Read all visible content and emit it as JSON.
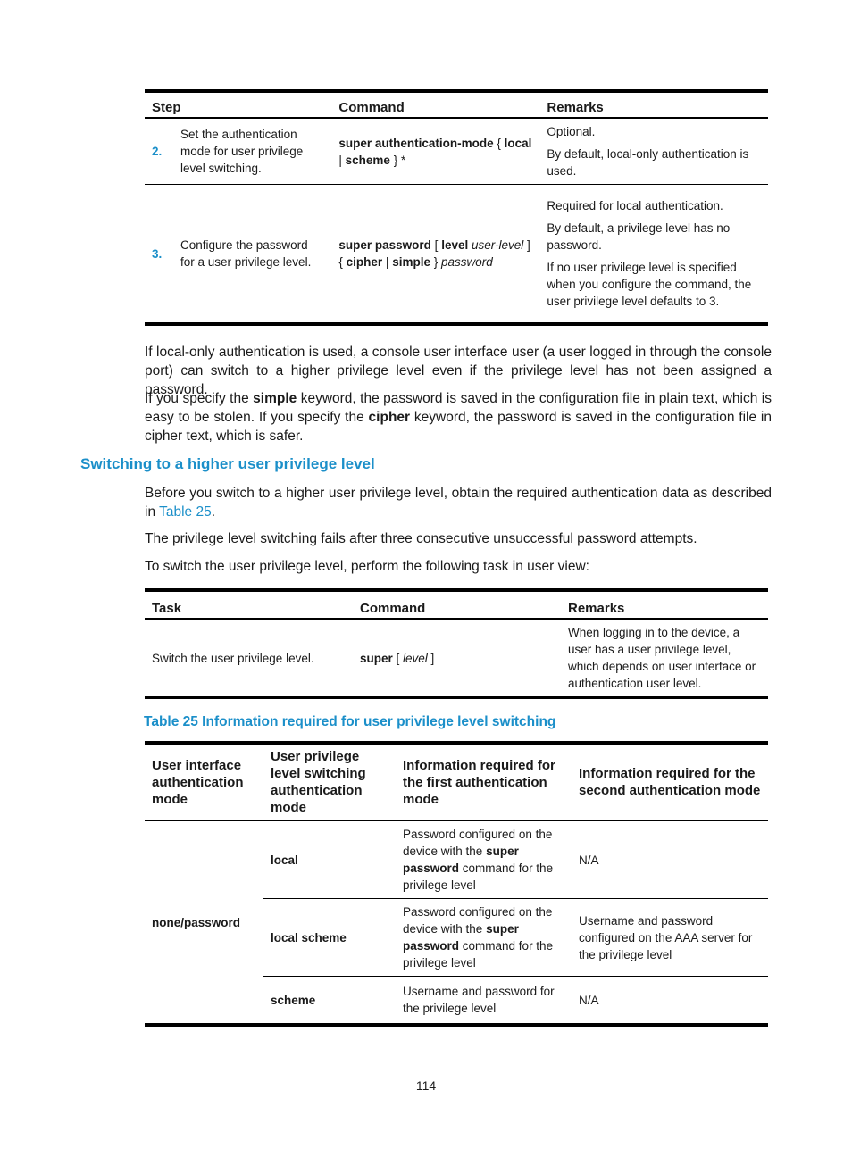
{
  "table1": {
    "headers": [
      "Step",
      "Command",
      "Remarks"
    ],
    "rows": [
      {
        "step": "2.",
        "description": "Set the authentication mode for user privilege level switching.",
        "command": {
          "kw1": "super authentication-mode",
          "t1": " { ",
          "kw2": "local",
          "t2": " | ",
          "kw3": "scheme",
          "t3": " } *"
        },
        "remarks": [
          "Optional.",
          "By default, local-only authentication is used."
        ]
      },
      {
        "step": "3.",
        "description": "Configure the password for a user privilege level.",
        "command": {
          "kw1": "super password",
          "t1": " [ ",
          "kw2": "level",
          "t2": " ",
          "arg1": "user-level",
          "t3": " ] { ",
          "kw3": "cipher",
          "t4": " | ",
          "kw4": "simple",
          "t5": " } ",
          "arg2": "password"
        },
        "remarks": [
          "Required for local authentication.",
          "By default, a privilege level has no password.",
          "If no user privilege level is specified when you configure the command, the user privilege level defaults to 3."
        ]
      }
    ]
  },
  "para1": "If local-only authentication is used, a console user interface user (a user logged in through the console port) can switch to a higher privilege level even if the privilege level has not been assigned a password.",
  "para2": {
    "t1": "If you specify the ",
    "kw1": "simple",
    "t2": " keyword, the password is saved in the configuration file in plain text, which is easy to be stolen. If you specify the ",
    "kw2": "cipher",
    "t3": " keyword, the password is saved in the configuration file in cipher text, which is safer."
  },
  "section_heading": "Switching to a higher user privilege level",
  "para3": {
    "t1": "Before you switch to a higher user privilege level, obtain the required authentication data as described in ",
    "link": "Table 25",
    "t2": "."
  },
  "para4": "The privilege level switching fails after three consecutive unsuccessful password attempts.",
  "para5": "To switch the user privilege level, perform the following task in user view:",
  "table2": {
    "headers": [
      "Task",
      "Command",
      "Remarks"
    ],
    "row": {
      "task": "Switch the user privilege level.",
      "command": {
        "kw": "super",
        "t1": " [ ",
        "arg": "level",
        "t2": " ]"
      },
      "remarks": "When logging in to the device, a user has a user privilege level, which depends on user interface or authentication user level."
    }
  },
  "table3": {
    "caption": "Table 25 Information required for user privilege level switching",
    "headers": [
      "User interface authentication mode",
      "User privilege level switching authentication mode",
      "Information required for the first authentication mode",
      "Information required for the second authentication mode"
    ],
    "ui_mode": "none/password",
    "rows": [
      {
        "switch_mode": "local",
        "first": {
          "t1": "Password configured on the device with the ",
          "kw1": "super password",
          "t2": " command for the privilege level"
        },
        "second": "N/A"
      },
      {
        "switch_mode": "local scheme",
        "first": {
          "t1": "Password configured on the device with the ",
          "kw1": "super password",
          "t2": " command for the privilege level"
        },
        "second": "Username and password configured on the AAA server for the privilege level"
      },
      {
        "switch_mode": "scheme",
        "first": {
          "t1": "Username and password for the privilege level",
          "kw1": "",
          "t2": ""
        },
        "second": "N/A"
      }
    ]
  },
  "page_number": "114",
  "colors": {
    "accent": "#1b8fc9",
    "text": "#1a1a1a",
    "rule": "#000000"
  }
}
